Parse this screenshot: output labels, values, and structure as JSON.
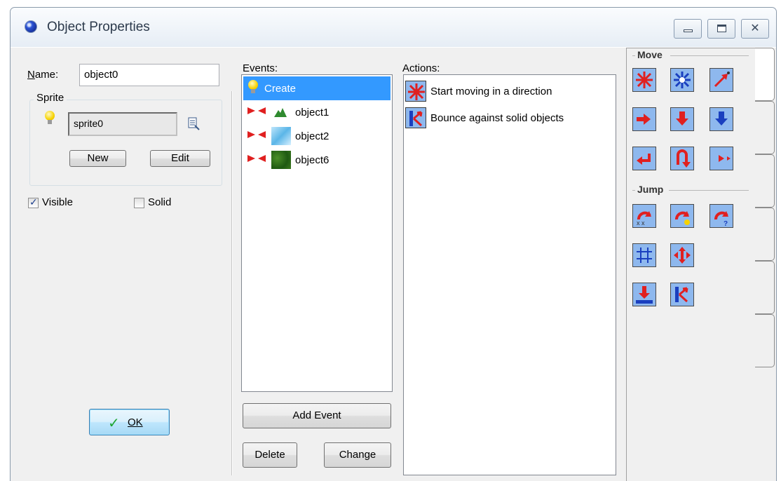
{
  "window": {
    "title": "Object Properties"
  },
  "props": {
    "name_label": "Name:",
    "name_value": "object0",
    "sprite_group": "Sprite",
    "sprite_value": "sprite0",
    "new_button": "New",
    "edit_button": "Edit",
    "visible_label": "Visible",
    "visible_checked": true,
    "solid_label": "Solid",
    "solid_checked": false,
    "ok_button": "OK"
  },
  "events": {
    "label": "Events:",
    "items": [
      {
        "label": "Create",
        "kind": "create",
        "selected": true
      },
      {
        "label": "object1",
        "kind": "collision"
      },
      {
        "label": "object2",
        "kind": "collision"
      },
      {
        "label": "object6",
        "kind": "collision"
      }
    ],
    "add_button": "Add Event",
    "delete_button": "Delete",
    "change_button": "Change"
  },
  "actions": {
    "label": "Actions:",
    "items": [
      {
        "label": "Start moving in a direction",
        "icon": "move-fixed-icon"
      },
      {
        "label": "Bounce against solid objects",
        "icon": "bounce-icon"
      }
    ]
  },
  "palette": {
    "move_header": "Move",
    "jump_header": "Jump"
  },
  "colors": {
    "selection": "#3399ff",
    "action_red": "#e02020",
    "action_blue": "#1a3fbf",
    "icon_bg": "#8eb8ee"
  }
}
